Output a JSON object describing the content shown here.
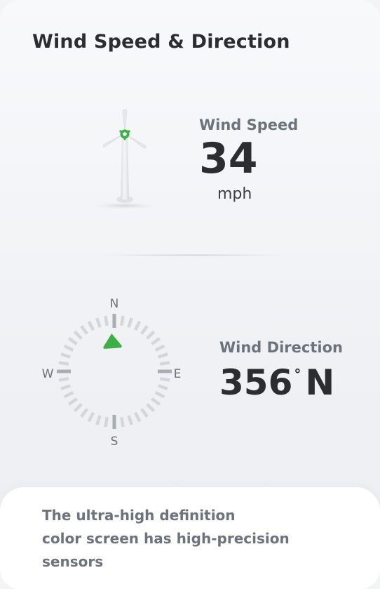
{
  "header": {
    "title": "Wind Speed & Direction"
  },
  "wind_speed": {
    "label": "Wind Speed",
    "value": "34",
    "unit": "mph"
  },
  "wind_direction": {
    "label": "Wind Direction",
    "degrees": "356",
    "degree_symbol": "°",
    "cardinal": "N",
    "heading_degrees": 356
  },
  "compass": {
    "north": "N",
    "east": "E",
    "south": "S",
    "west": "W",
    "tick_color": "#d4d6da",
    "major_tick_color": "#a9adb3",
    "pointer_color": "#3cb044"
  },
  "turbine": {
    "hub_color": "#3cb044",
    "body_color": "#e9ebee"
  },
  "footer": {
    "line1": "The ultra-high definition",
    "line2": "color screen has high-precision",
    "line3": "sensors"
  },
  "colors": {
    "accent": "#3cb044",
    "text_primary": "#2b2d31",
    "text_secondary": "#6c737d"
  }
}
